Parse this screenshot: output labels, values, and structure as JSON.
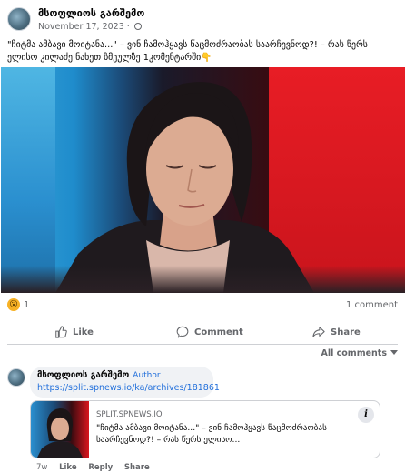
{
  "post": {
    "author": "მსოფლიოს გარშემო",
    "date": "November 17, 2023",
    "separator": "·",
    "text": "\"ჩიტმა ამბავი მოიტანა...\" – ვინ ჩამოჰყავს წაცმოძრაობას საარჩევნოდ?! – რას წერს ელისო კილაძე ნახეთ ზმეულზე  1კომენტარში👇"
  },
  "stats": {
    "reaction_emoji": "😮",
    "reaction_count": "1",
    "comment_count": "1 comment"
  },
  "actions": {
    "like": "Like",
    "comment": "Comment",
    "share": "Share"
  },
  "comments_sort": "All comments",
  "comment": {
    "author": "მსოფლიოს გარშემო",
    "badge": "Author",
    "link": "https://split.spnews.io/ka/archives/181861",
    "card": {
      "site": "SPLIT.SPNEWS.IO",
      "title": "\"ჩიტმა ამბავი მოიტანა...\" – ვინ ჩამოჰყავს წაცმოძრაობას საარჩევნოდ?! – რას წერს ელისო...",
      "info": "i"
    },
    "age": "7w",
    "like": "Like",
    "reply": "Reply",
    "share": "Share"
  },
  "colors": {
    "link_blue": "#216fdb",
    "meta_gray": "#65676b",
    "studio_red": "#e01c22",
    "studio_blue": "#2a8fcf"
  }
}
